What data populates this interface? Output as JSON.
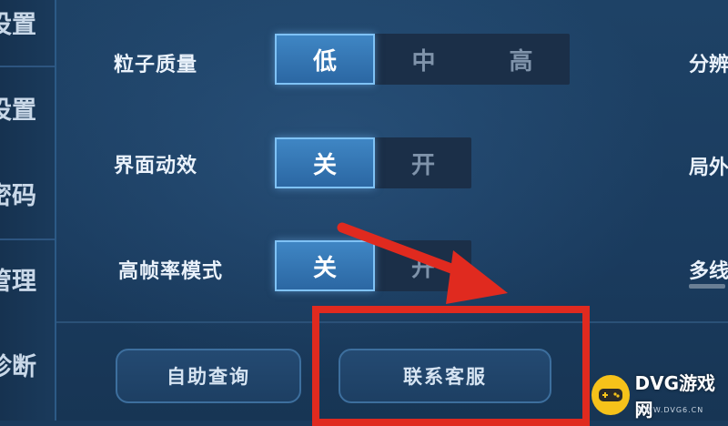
{
  "sidebar": {
    "items": [
      {
        "label": "设置"
      },
      {
        "label": "设置"
      },
      {
        "label": "密码"
      },
      {
        "label": "管理"
      },
      {
        "label": "诊断"
      }
    ]
  },
  "settings": {
    "particle_quality": {
      "label": "粒子质量",
      "options": [
        "低",
        "中",
        "高"
      ],
      "selected": "低"
    },
    "ui_animation": {
      "label": "界面动效",
      "options": [
        "关",
        "开"
      ],
      "selected": "关"
    },
    "high_fps_mode": {
      "label": "高帧率模式",
      "options": [
        "关",
        "开"
      ],
      "selected": "关"
    }
  },
  "right_column": {
    "labels": [
      "分辨",
      "局外",
      "多线"
    ]
  },
  "buttons": {
    "self_service": "自助查询",
    "contact_support": "联系客服"
  },
  "annotation": {
    "color": "#e02a1f"
  },
  "watermark": {
    "text": "DVG游戏网",
    "sub": "WWW.DVG6.CN"
  }
}
